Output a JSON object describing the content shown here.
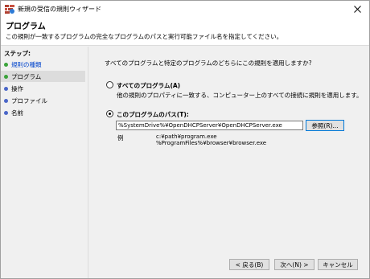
{
  "window": {
    "title": "新規の受信の規則ウィザード"
  },
  "header": {
    "title": "プログラム",
    "description": "この規則が一致するプログラムの完全なプログラムのパスと実行可能ファイル名を指定してください。"
  },
  "steps": {
    "title": "ステップ:",
    "items": [
      {
        "label": "規則の種類",
        "state": "done"
      },
      {
        "label": "プログラム",
        "state": "current"
      },
      {
        "label": "操作",
        "state": "todo"
      },
      {
        "label": "プロファイル",
        "state": "todo"
      },
      {
        "label": "名前",
        "state": "todo"
      }
    ]
  },
  "main": {
    "question": "すべてのプログラムと特定のプログラムのどちらにこの規則を適用しますか?",
    "all_programs": {
      "label": "すべてのプログラム(A)",
      "description": "他の規則のプロパティに一致する、コンピューター上のすべての接続に規則を適用します。",
      "checked": false
    },
    "this_program": {
      "label": "このプログラムのパス(T):",
      "checked": true,
      "path_value": "%SystemDrive%¥OpenDHCPServer¥OpenDHCPServer.exe",
      "browse_label": "参照(R)..."
    },
    "example": {
      "label": "例",
      "lines": [
        "c:¥path¥program.exe",
        "%ProgramFiles%¥browser¥browser.exe"
      ]
    }
  },
  "footer": {
    "back_label": "< 戻る(B)",
    "next_label": "次へ(N) >",
    "cancel_label": "キャンセル"
  },
  "colors": {
    "done_step": "#3aa33a",
    "todo_step": "#4a66c8",
    "link": "#0044cc",
    "focus": "#0078d7"
  }
}
